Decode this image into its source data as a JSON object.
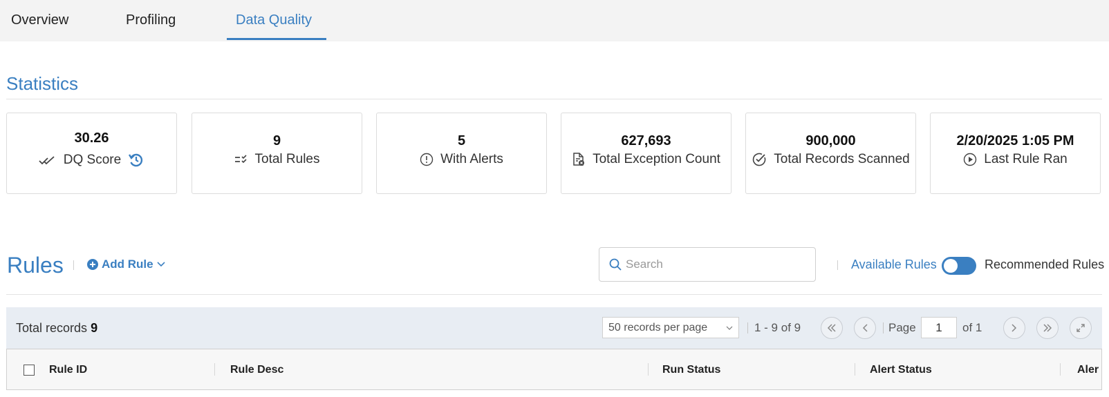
{
  "tabs": [
    {
      "label": "Overview"
    },
    {
      "label": "Profiling"
    },
    {
      "label": "Data Quality"
    }
  ],
  "statistics": {
    "title": "Statistics",
    "cards": [
      {
        "value": "30.26",
        "label": "DQ Score",
        "icon": "double-check-icon",
        "extra_icon": "history-icon"
      },
      {
        "value": "9",
        "label": "Total Rules",
        "icon": "rules-list-icon"
      },
      {
        "value": "5",
        "label": "With Alerts",
        "icon": "alert-circle-icon"
      },
      {
        "value": "627,693",
        "label": "Total Exception Count",
        "icon": "file-error-icon"
      },
      {
        "value": "900,000",
        "label": "Total Records Scanned",
        "icon": "check-circle-icon"
      },
      {
        "value": "2/20/2025 1:05 PM",
        "label": "Last Rule Ran",
        "icon": "play-circle-icon"
      }
    ]
  },
  "rules": {
    "title": "Rules",
    "add_rule_label": "Add Rule",
    "search_placeholder": "Search",
    "available_rules_label": "Available Rules",
    "recommended_rules_label": "Recommended Rules",
    "toggle_state": "available"
  },
  "table": {
    "total_records_label": "Total records",
    "total_records_value": "9",
    "per_page": "50 records per page",
    "range": "1 - 9 of 9",
    "page_label": "Page",
    "page_value": "1",
    "of_label": "of 1",
    "columns": [
      "Rule ID",
      "Rule Desc",
      "Run Status",
      "Alert Status",
      "Aler"
    ]
  },
  "colors": {
    "accent": "#3a7fc1",
    "tab_bar_bg": "#f3f3f3",
    "toolbar_bg": "#e8edf3"
  }
}
